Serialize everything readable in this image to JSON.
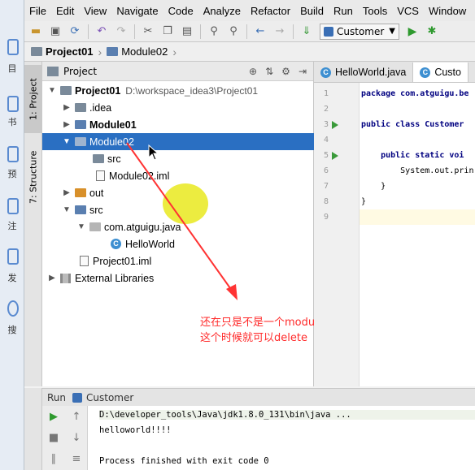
{
  "outer": {
    "items": [
      "目",
      "书",
      "预",
      "注",
      "发",
      "搜"
    ]
  },
  "menu": [
    "File",
    "Edit",
    "View",
    "Navigate",
    "Code",
    "Analyze",
    "Refactor",
    "Build",
    "Run",
    "Tools",
    "VCS",
    "Window"
  ],
  "toolbar": {
    "run_config": "Customer"
  },
  "breadcrumb": {
    "project": "Project01",
    "module": "Module02"
  },
  "sidetabs": {
    "project": "1: Project",
    "structure": "7: Structure"
  },
  "project_panel": {
    "title": "Project",
    "rows": [
      {
        "label": "Project01",
        "hint": "D:\\workspace_idea3\\Project01"
      },
      {
        "label": ".idea"
      },
      {
        "label": "Module01"
      },
      {
        "label": "Module02"
      },
      {
        "label": "src"
      },
      {
        "label": "Module02.iml"
      },
      {
        "label": "out"
      },
      {
        "label": "src"
      },
      {
        "label": "com.atguigu.java"
      },
      {
        "label": "HelloWorld"
      },
      {
        "label": "Project01.iml"
      },
      {
        "label": "External Libraries"
      }
    ]
  },
  "editor": {
    "tabs": [
      "HelloWorld.java",
      "Custo"
    ],
    "lines": [
      {
        "no": "1",
        "text": "package com.atguigu.be"
      },
      {
        "no": "2",
        "text": ""
      },
      {
        "no": "3",
        "text": "public class Customer"
      },
      {
        "no": "4",
        "text": ""
      },
      {
        "no": "5",
        "text": "    public static voi"
      },
      {
        "no": "6",
        "text": "        System.out.prin"
      },
      {
        "no": "7",
        "text": "    }"
      },
      {
        "no": "8",
        "text": "}"
      },
      {
        "no": "9",
        "text": ""
      }
    ]
  },
  "annotation": {
    "line1": "还在只是不是一个module了",
    "line2": "这个时候就可以delete"
  },
  "run": {
    "tab": "Run",
    "config": "Customer",
    "console": [
      "D:\\developer_tools\\Java\\jdk1.8.0_131\\bin\\java ...",
      "helloworld!!!!",
      "",
      "Process finished with exit code 0"
    ]
  }
}
